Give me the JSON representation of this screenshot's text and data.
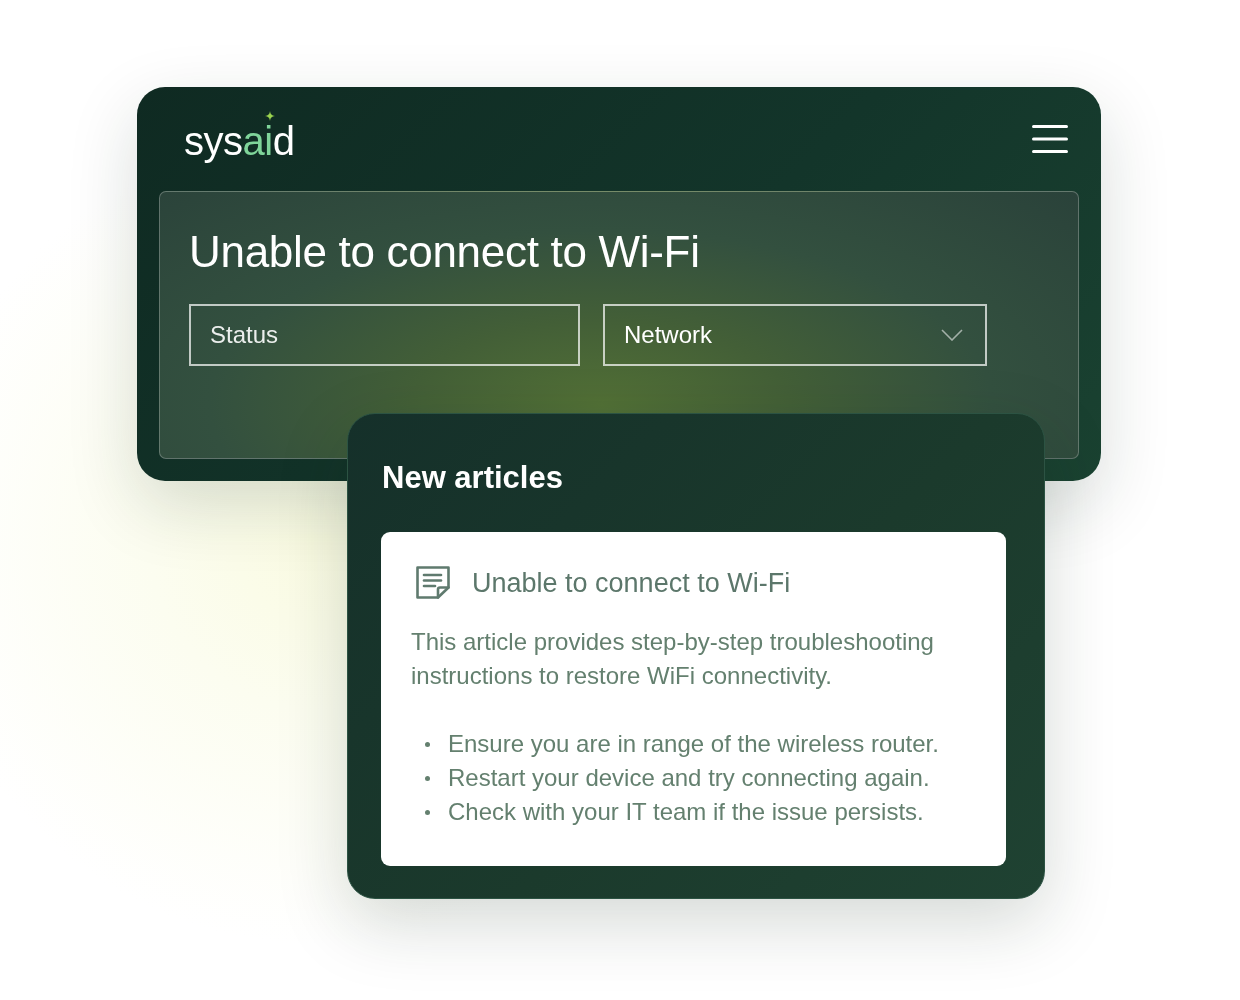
{
  "header": {
    "logo": [
      {
        "text": "sys",
        "accent": false
      },
      {
        "text": "ai",
        "accent": true
      },
      {
        "text": "d",
        "accent": false
      }
    ]
  },
  "ticket": {
    "title": "Unable to connect to Wi-Fi",
    "fields": [
      {
        "kind": "input",
        "placeholder": "Status"
      },
      {
        "kind": "dropdown",
        "value": "Network"
      }
    ]
  },
  "articles_panel": {
    "title": "New articles",
    "articles": [
      {
        "title": "Unable to connect to Wi-Fi",
        "description": "This article provides step-by-step troubleshooting instructions to restore WiFi connectivity.",
        "steps": [
          "Ensure you are in range of the wireless router.",
          "Restart your device and try connecting again.",
          "Check with your IT team if the issue persists."
        ]
      }
    ]
  }
}
